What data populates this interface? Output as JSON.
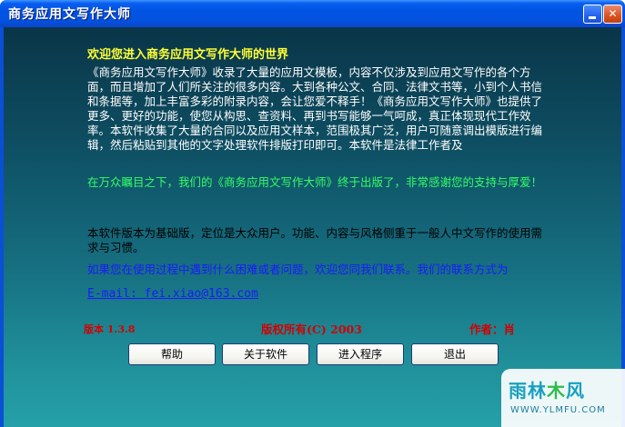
{
  "window": {
    "title": "商务应用文写作大师",
    "minimize_glyph": "",
    "close_glyph": "✕"
  },
  "content": {
    "heading": "欢迎您进入商务应用文写作大师的世界",
    "para1": "《商务应用文写作大师》收录了大量的应用文模板，内容不仅涉及到应用文写作的各个方面，而且增加了人们所关注的很多内容。大到各种公文、合同、法律文书等，小到个人书信和条据等，加上丰富多彩的附录内容，会让您爱不释手！《商务应用文写作大师》也提供了更多、更好的功能，使您从构思、查资料、再到书写能够一气呵成，真正体现现代工作效率。本软件收集了大量的合同以及应用文样本，范围极其广泛，用户可随意调出模版进行编辑，然后粘贴到其他的文字处理软件排版打印即可。本软件是法律工作者及",
    "para2": "在万众瞩目之下，我们的《商务应用文写作大师》终于出版了，非常感谢您的支持与厚爱！",
    "para3": "本软件版本为基础版，定位是大众用户。功能、内容与风格侧重于一般人中文写作的使用需求与习惯。",
    "para4": "如果您在使用过程中遇到什么困难或者问题，欢迎您同我们联系。我们的联系方式为",
    "email": "E-mail: fei.xiao@163.com"
  },
  "footer": {
    "version": "版本 1.3.8",
    "copyright": "版权所有(C) 2003",
    "author": "作者：肖"
  },
  "buttons": {
    "help": "帮助",
    "about": "关于软件",
    "enter": "进入程序",
    "exit": "退出"
  },
  "watermark": {
    "logo_left": "雨林",
    "logo_mid": "木",
    "logo_right": "风",
    "url": "WWW.YLMFU.COM"
  },
  "colors": {
    "titlebar": "#0054e3",
    "heading": "#ffff33",
    "body_text": "#ffffff",
    "thanks_text": "#33ff66",
    "contact_text": "#1a1aff",
    "footer_text": "#d40000"
  }
}
